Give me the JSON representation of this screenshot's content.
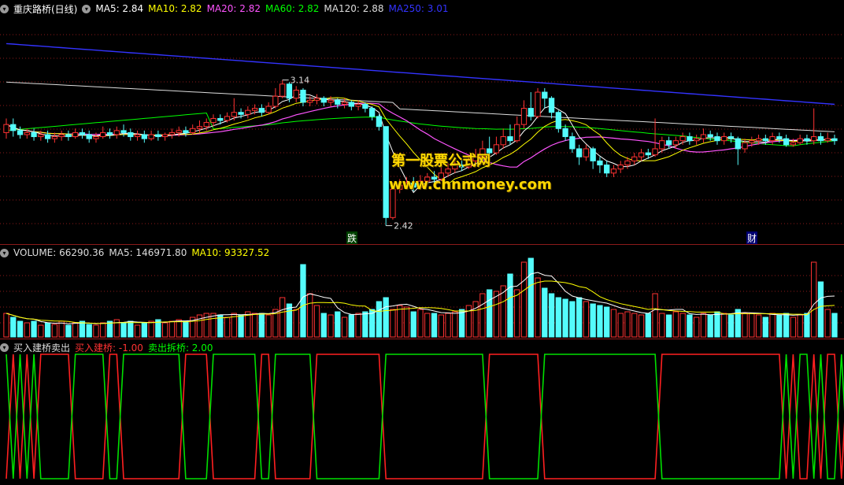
{
  "legend_main": {
    "stock_name": "重庆路桥(日线)",
    "items": [
      {
        "label": "MA5: 2.84",
        "color": "#ffffff"
      },
      {
        "label": "MA10: 2.82",
        "color": "#ffff00"
      },
      {
        "label": "MA20: 2.82",
        "color": "#ff55ff"
      },
      {
        "label": "MA60: 2.82",
        "color": "#00ff00"
      },
      {
        "label": "MA120: 2.88",
        "color": "#dddddd"
      },
      {
        "label": "MA250: 3.01",
        "color": "#3333ff"
      }
    ]
  },
  "legend_volume": {
    "items": [
      {
        "label": "VOLUME: 66290.36",
        "color": "#dddddd"
      },
      {
        "label": "MA5: 146971.80",
        "color": "#dddddd"
      },
      {
        "label": "MA10: 93327.52",
        "color": "#ffff00"
      }
    ]
  },
  "legend_indicator": {
    "items": [
      {
        "label": "买入建桥卖出",
        "color": "#dddddd"
      },
      {
        "label": "买入建桥: -1.00",
        "color": "#ff3333"
      },
      {
        "label": "卖出拆桥: 2.00",
        "color": "#00ff00"
      }
    ]
  },
  "annotations": {
    "high_label": "3.14",
    "low_label": "2.42",
    "tag_drop": "跌",
    "tag_fin": "财"
  },
  "watermark": {
    "line1": "第一股票公式网",
    "line2": "www.chnmoney.com"
  },
  "colors": {
    "up": "#ff3232",
    "down": "#54fcfc",
    "ma5": "#ffffff",
    "ma10": "#ffff00",
    "ma20": "#ff55ff",
    "ma60": "#00ff00",
    "ma120": "#dddddd",
    "ma250": "#3333ff",
    "grid": "#8b1a1a"
  },
  "chart_data": {
    "type": "candlestick",
    "price_range": [
      2.36,
      3.45
    ],
    "candles": [
      [
        2.88,
        2.92,
        2.95,
        2.85
      ],
      [
        2.92,
        2.89,
        2.95,
        2.86
      ],
      [
        2.89,
        2.87,
        2.91,
        2.85
      ],
      [
        2.87,
        2.88,
        2.9,
        2.85
      ],
      [
        2.88,
        2.86,
        2.9,
        2.84
      ],
      [
        2.86,
        2.87,
        2.89,
        2.84
      ],
      [
        2.87,
        2.85,
        2.89,
        2.83
      ],
      [
        2.85,
        2.86,
        2.88,
        2.83
      ],
      [
        2.86,
        2.87,
        2.89,
        2.84
      ],
      [
        2.87,
        2.86,
        2.89,
        2.84
      ],
      [
        2.86,
        2.88,
        2.9,
        2.85
      ],
      [
        2.88,
        2.87,
        2.9,
        2.85
      ],
      [
        2.87,
        2.85,
        2.89,
        2.83
      ],
      [
        2.85,
        2.86,
        2.88,
        2.83
      ],
      [
        2.86,
        2.88,
        2.91,
        2.85
      ],
      [
        2.88,
        2.87,
        2.9,
        2.85
      ],
      [
        2.87,
        2.89,
        2.91,
        2.85
      ],
      [
        2.89,
        2.88,
        2.92,
        2.86
      ],
      [
        2.88,
        2.86,
        2.9,
        2.84
      ],
      [
        2.86,
        2.87,
        2.89,
        2.84
      ],
      [
        2.87,
        2.85,
        2.89,
        2.83
      ],
      [
        2.85,
        2.87,
        2.89,
        2.84
      ],
      [
        2.87,
        2.86,
        2.89,
        2.84
      ],
      [
        2.86,
        2.87,
        2.88,
        2.84
      ],
      [
        2.87,
        2.88,
        2.9,
        2.85
      ],
      [
        2.88,
        2.89,
        2.91,
        2.86
      ],
      [
        2.89,
        2.88,
        2.91,
        2.86
      ],
      [
        2.88,
        2.9,
        2.92,
        2.87
      ],
      [
        2.9,
        2.91,
        2.94,
        2.88
      ],
      [
        2.91,
        2.93,
        2.95,
        2.89
      ],
      [
        2.93,
        2.95,
        2.97,
        2.91
      ],
      [
        2.95,
        2.94,
        2.97,
        2.92
      ],
      [
        2.94,
        2.96,
        2.98,
        2.93
      ],
      [
        2.96,
        2.98,
        3.05,
        2.94
      ],
      [
        2.98,
        2.97,
        3.0,
        2.95
      ],
      [
        2.97,
        2.99,
        3.01,
        2.95
      ],
      [
        2.99,
        3.0,
        3.02,
        2.97
      ],
      [
        3.0,
        2.98,
        3.02,
        2.96
      ],
      [
        2.98,
        3.01,
        3.03,
        2.97
      ],
      [
        3.01,
        3.06,
        3.1,
        3.0
      ],
      [
        3.06,
        3.12,
        3.14,
        3.05
      ],
      [
        3.12,
        3.05,
        3.13,
        3.03
      ],
      [
        3.05,
        3.09,
        3.11,
        3.03
      ],
      [
        3.09,
        3.03,
        3.1,
        3.01
      ],
      [
        3.03,
        3.04,
        3.06,
        3.01
      ],
      [
        3.04,
        3.05,
        3.07,
        3.02
      ],
      [
        3.05,
        3.03,
        3.06,
        3.01
      ],
      [
        3.03,
        3.04,
        3.06,
        3.01
      ],
      [
        3.04,
        3.02,
        3.05,
        3.0
      ],
      [
        3.02,
        3.03,
        3.05,
        3.0
      ],
      [
        3.03,
        3.01,
        3.04,
        2.99
      ],
      [
        3.01,
        3.02,
        3.04,
        2.99
      ],
      [
        3.02,
        3.0,
        3.03,
        2.98
      ],
      [
        3.0,
        2.96,
        3.01,
        2.94
      ],
      [
        2.96,
        2.91,
        2.97,
        2.89
      ],
      [
        2.91,
        2.46,
        2.91,
        2.42
      ],
      [
        2.46,
        2.6,
        2.63,
        2.45
      ],
      [
        2.6,
        2.62,
        2.65,
        2.58
      ],
      [
        2.62,
        2.63,
        2.66,
        2.6
      ],
      [
        2.63,
        2.61,
        2.66,
        2.59
      ],
      [
        2.61,
        2.64,
        2.67,
        2.6
      ],
      [
        2.64,
        2.66,
        2.68,
        2.62
      ],
      [
        2.66,
        2.65,
        2.69,
        2.63
      ],
      [
        2.65,
        2.68,
        2.71,
        2.64
      ],
      [
        2.68,
        2.7,
        2.73,
        2.66
      ],
      [
        2.7,
        2.72,
        2.75,
        2.68
      ],
      [
        2.72,
        2.71,
        2.75,
        2.69
      ],
      [
        2.71,
        2.74,
        2.77,
        2.7
      ],
      [
        2.74,
        2.76,
        2.8,
        2.72
      ],
      [
        2.76,
        2.8,
        2.84,
        2.74
      ],
      [
        2.8,
        2.78,
        2.86,
        2.76
      ],
      [
        2.78,
        2.82,
        2.86,
        2.77
      ],
      [
        2.82,
        2.86,
        2.9,
        2.8
      ],
      [
        2.86,
        2.84,
        2.92,
        2.82
      ],
      [
        2.84,
        2.92,
        2.96,
        2.83
      ],
      [
        2.92,
        3.0,
        3.04,
        2.9
      ],
      [
        3.0,
        2.96,
        3.08,
        2.94
      ],
      [
        2.96,
        3.08,
        3.1,
        2.95
      ],
      [
        3.08,
        3.05,
        3.1,
        3.0
      ],
      [
        3.05,
        2.98,
        3.06,
        2.95
      ],
      [
        2.98,
        2.9,
        2.99,
        2.88
      ],
      [
        2.9,
        2.86,
        2.92,
        2.84
      ],
      [
        2.86,
        2.8,
        2.88,
        2.78
      ],
      [
        2.8,
        2.76,
        2.82,
        2.72
      ],
      [
        2.76,
        2.8,
        2.82,
        2.74
      ],
      [
        2.8,
        2.74,
        2.81,
        2.7
      ],
      [
        2.74,
        2.72,
        2.76,
        2.68
      ],
      [
        2.72,
        2.68,
        2.74,
        2.66
      ],
      [
        2.68,
        2.7,
        2.72,
        2.66
      ],
      [
        2.7,
        2.72,
        2.74,
        2.68
      ],
      [
        2.72,
        2.74,
        2.76,
        2.7
      ],
      [
        2.74,
        2.76,
        2.78,
        2.72
      ],
      [
        2.76,
        2.78,
        2.8,
        2.74
      ],
      [
        2.78,
        2.77,
        2.8,
        2.75
      ],
      [
        2.77,
        2.8,
        2.95,
        2.76
      ],
      [
        2.8,
        2.84,
        2.86,
        2.78
      ],
      [
        2.84,
        2.82,
        2.86,
        2.8
      ],
      [
        2.82,
        2.84,
        2.86,
        2.8
      ],
      [
        2.84,
        2.86,
        2.88,
        2.82
      ],
      [
        2.86,
        2.84,
        2.88,
        2.82
      ],
      [
        2.84,
        2.85,
        2.87,
        2.82
      ],
      [
        2.85,
        2.87,
        2.9,
        2.83
      ],
      [
        2.87,
        2.86,
        2.89,
        2.84
      ],
      [
        2.86,
        2.84,
        2.88,
        2.82
      ],
      [
        2.84,
        2.86,
        2.88,
        2.82
      ],
      [
        2.86,
        2.85,
        2.88,
        2.83
      ],
      [
        2.85,
        2.8,
        2.86,
        2.72
      ],
      [
        2.8,
        2.83,
        2.85,
        2.78
      ],
      [
        2.83,
        2.84,
        2.86,
        2.81
      ],
      [
        2.84,
        2.85,
        2.87,
        2.82
      ],
      [
        2.85,
        2.84,
        2.87,
        2.82
      ],
      [
        2.84,
        2.86,
        2.88,
        2.82
      ],
      [
        2.86,
        2.85,
        2.88,
        2.83
      ],
      [
        2.85,
        2.82,
        2.87,
        2.81
      ],
      [
        2.82,
        2.83,
        2.85,
        2.81
      ],
      [
        2.83,
        2.85,
        2.87,
        2.82
      ],
      [
        2.85,
        2.84,
        2.87,
        2.82
      ],
      [
        2.84,
        2.86,
        3.0,
        2.82
      ],
      [
        2.86,
        2.84,
        2.88,
        2.82
      ],
      [
        2.84,
        2.85,
        2.88,
        2.83
      ],
      [
        2.85,
        2.84,
        2.87,
        2.82
      ]
    ],
    "volume": [
      0.3,
      0.25,
      0.2,
      0.18,
      0.2,
      0.15,
      0.18,
      0.16,
      0.2,
      0.15,
      0.18,
      0.2,
      0.16,
      0.15,
      0.18,
      0.2,
      0.22,
      0.18,
      0.2,
      0.15,
      0.18,
      0.2,
      0.22,
      0.18,
      0.2,
      0.22,
      0.2,
      0.25,
      0.28,
      0.3,
      0.3,
      0.28,
      0.25,
      0.3,
      0.28,
      0.32,
      0.3,
      0.3,
      0.28,
      0.35,
      0.5,
      0.42,
      0.35,
      0.92,
      0.55,
      0.4,
      0.3,
      0.28,
      0.32,
      0.25,
      0.28,
      0.3,
      0.32,
      0.35,
      0.45,
      0.5,
      0.35,
      0.4,
      0.38,
      0.32,
      0.35,
      0.3,
      0.3,
      0.28,
      0.3,
      0.32,
      0.35,
      0.4,
      0.45,
      0.55,
      0.6,
      0.58,
      0.65,
      0.8,
      0.6,
      0.95,
      1.0,
      0.75,
      0.62,
      0.55,
      0.5,
      0.48,
      0.45,
      0.5,
      0.45,
      0.42,
      0.4,
      0.38,
      0.35,
      0.3,
      0.32,
      0.3,
      0.28,
      0.3,
      0.55,
      0.3,
      0.28,
      0.32,
      0.3,
      0.28,
      0.25,
      0.3,
      0.28,
      0.32,
      0.3,
      0.28,
      0.35,
      0.3,
      0.3,
      0.28,
      0.25,
      0.3,
      0.28,
      0.3,
      0.25,
      0.28,
      0.3,
      0.95,
      0.7,
      0.35,
      0.3
    ],
    "indicator": [
      0,
      1,
      0,
      1,
      0,
      1,
      1,
      1,
      1,
      1,
      0,
      0,
      0,
      0,
      0,
      1,
      1,
      0,
      0,
      0,
      0,
      0,
      0,
      0,
      0,
      0,
      1,
      1,
      1,
      1,
      0,
      0,
      0,
      0,
      0,
      0,
      0,
      1,
      1,
      0,
      0,
      0,
      0,
      0,
      0,
      1,
      1,
      1,
      1,
      1,
      1,
      1,
      1,
      1,
      1,
      0,
      0,
      0,
      0,
      0,
      0,
      0,
      0,
      0,
      0,
      0,
      0,
      0,
      0,
      0,
      1,
      1,
      1,
      1,
      1,
      1,
      1,
      1,
      0,
      0,
      0,
      0,
      0,
      0,
      0,
      0,
      0,
      0,
      0,
      0,
      0,
      0,
      0,
      0,
      0,
      1,
      1,
      1,
      1,
      1,
      1,
      1,
      1,
      1,
      1,
      1,
      1,
      1,
      1,
      1,
      1,
      1,
      1,
      0,
      1,
      0,
      0,
      1,
      0,
      1,
      1,
      0,
      1,
      1
    ]
  }
}
